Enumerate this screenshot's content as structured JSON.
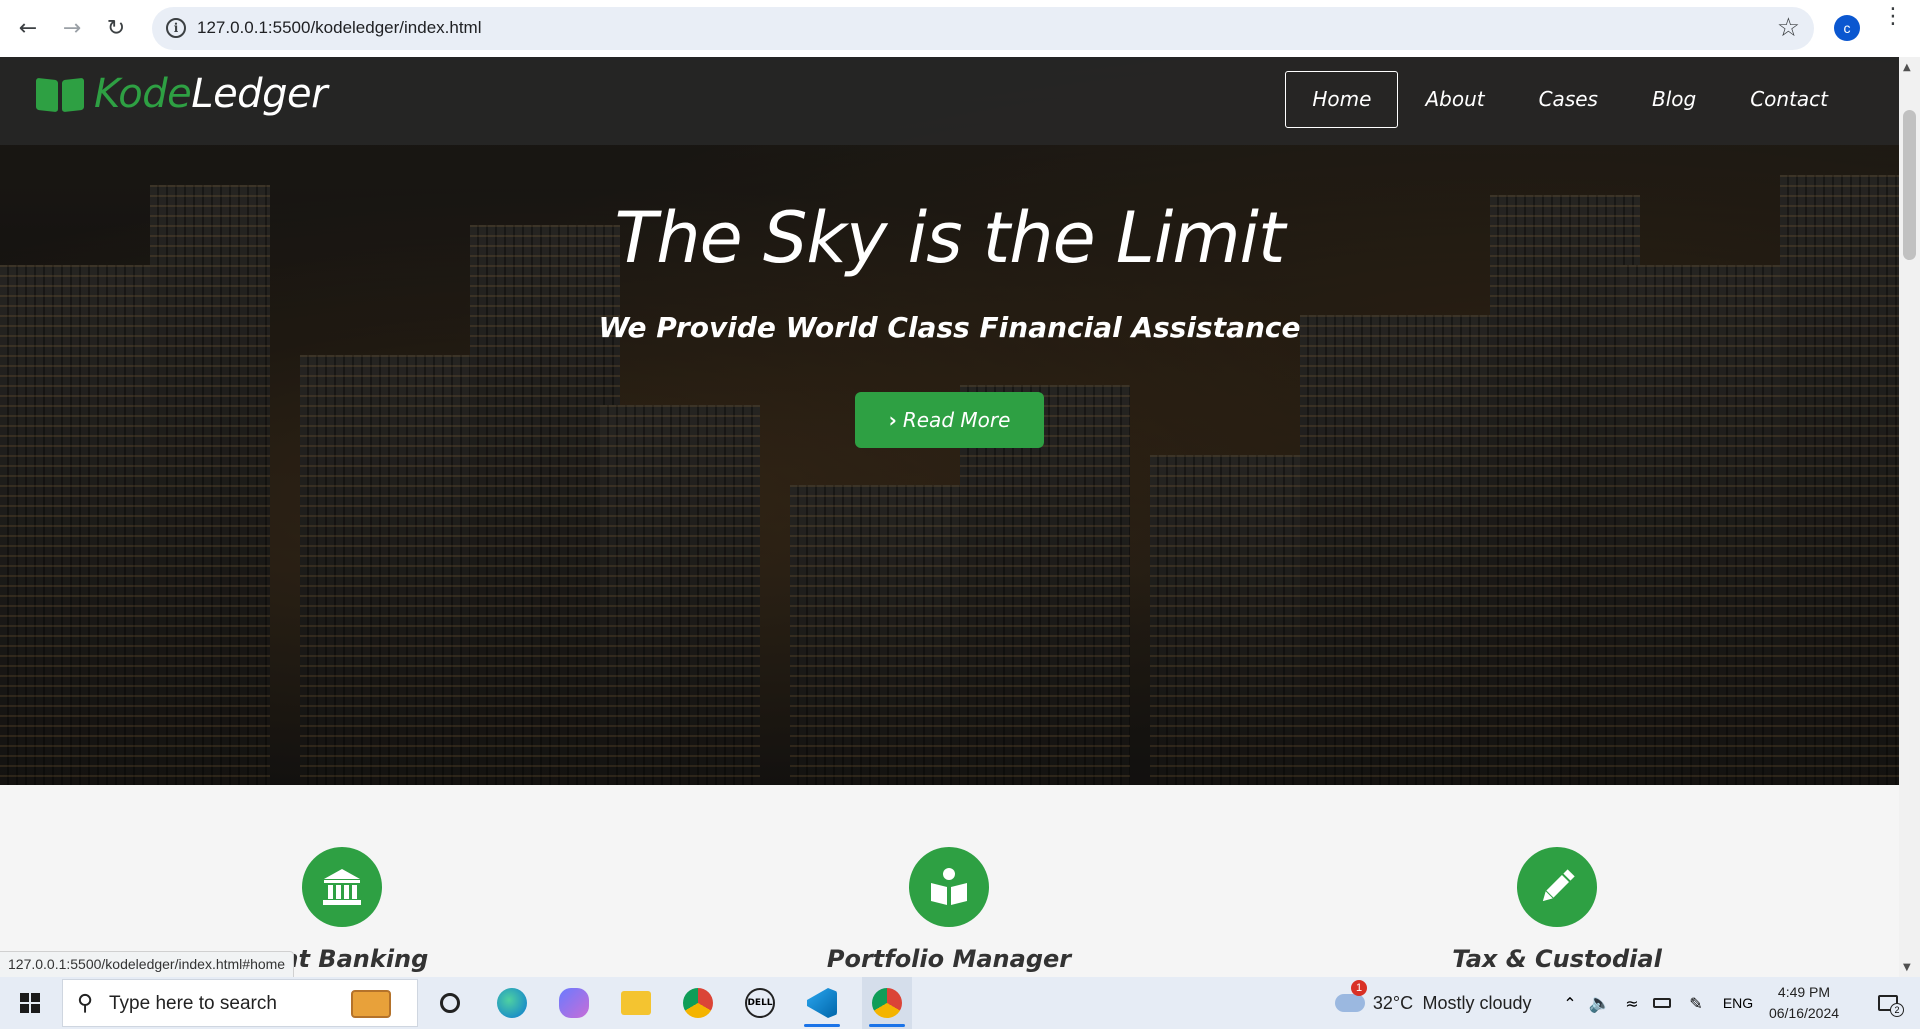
{
  "browser": {
    "url": "127.0.0.1:5500/kodeledger/index.html",
    "profile_initial": "c",
    "status_url": "127.0.0.1:5500/kodeledger/index.html#home"
  },
  "site": {
    "brand_kode": "Kode",
    "brand_ledger": "Ledger",
    "nav": [
      {
        "label": "Home",
        "active": true
      },
      {
        "label": "About",
        "active": false
      },
      {
        "label": "Cases",
        "active": false
      },
      {
        "label": "Blog",
        "active": false
      },
      {
        "label": "Contact",
        "active": false
      }
    ],
    "hero": {
      "title": "The Sky is the Limit",
      "subtitle": "We Provide World Class Financial Assistance",
      "cta_label": "Read More"
    },
    "features": [
      {
        "title": "Investment Banking",
        "visible_title": "nent Banking",
        "icon": "bank-icon"
      },
      {
        "title": "Portfolio Manager",
        "visible_title": "Portfolio Manager",
        "icon": "book-reader-icon"
      },
      {
        "title": "Tax & Custodial",
        "visible_title": "Tax & Custodial",
        "icon": "pencil-icon"
      }
    ],
    "accent_color": "#2ea043"
  },
  "taskbar": {
    "search_placeholder": "Type here to search",
    "weather_temp": "32°C",
    "weather_desc": "Mostly cloudy",
    "weather_badge": "1",
    "language": "ENG",
    "time": "4:49 PM",
    "date": "06/16/2024",
    "notification_count": "2"
  }
}
